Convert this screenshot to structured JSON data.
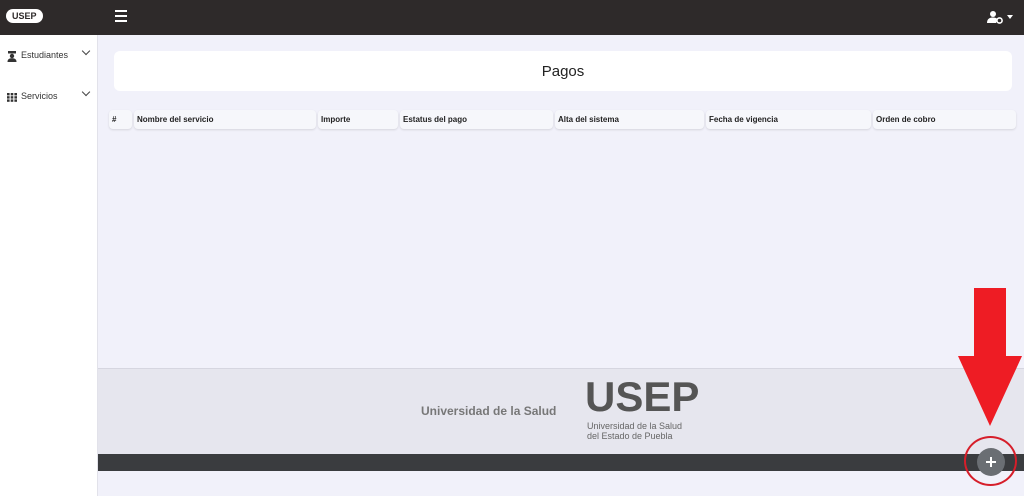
{
  "header": {
    "brand": "USEP"
  },
  "sidebar": {
    "items": [
      {
        "label": "Estudiantes",
        "icon": "graduate-icon"
      },
      {
        "label": "Servicios",
        "icon": "grid-icon"
      }
    ]
  },
  "main": {
    "title": "Pagos",
    "table": {
      "columns": [
        "#",
        "Nombre del servicio",
        "Importe",
        "Estatus del pago",
        "Alta del sistema",
        "Fecha de vigencia",
        "Orden de cobro"
      ],
      "rows": []
    }
  },
  "footer": {
    "university_label": "Universidad de la Salud",
    "logo_text": "USEP",
    "logo_subtitle_line1": "Universidad de la Salud",
    "logo_subtitle_line2": "del Estado de Puebla"
  },
  "colors": {
    "topbar": "#2e2a2a",
    "annotation_red": "#d61e2a",
    "fab": "#6a6e73"
  }
}
